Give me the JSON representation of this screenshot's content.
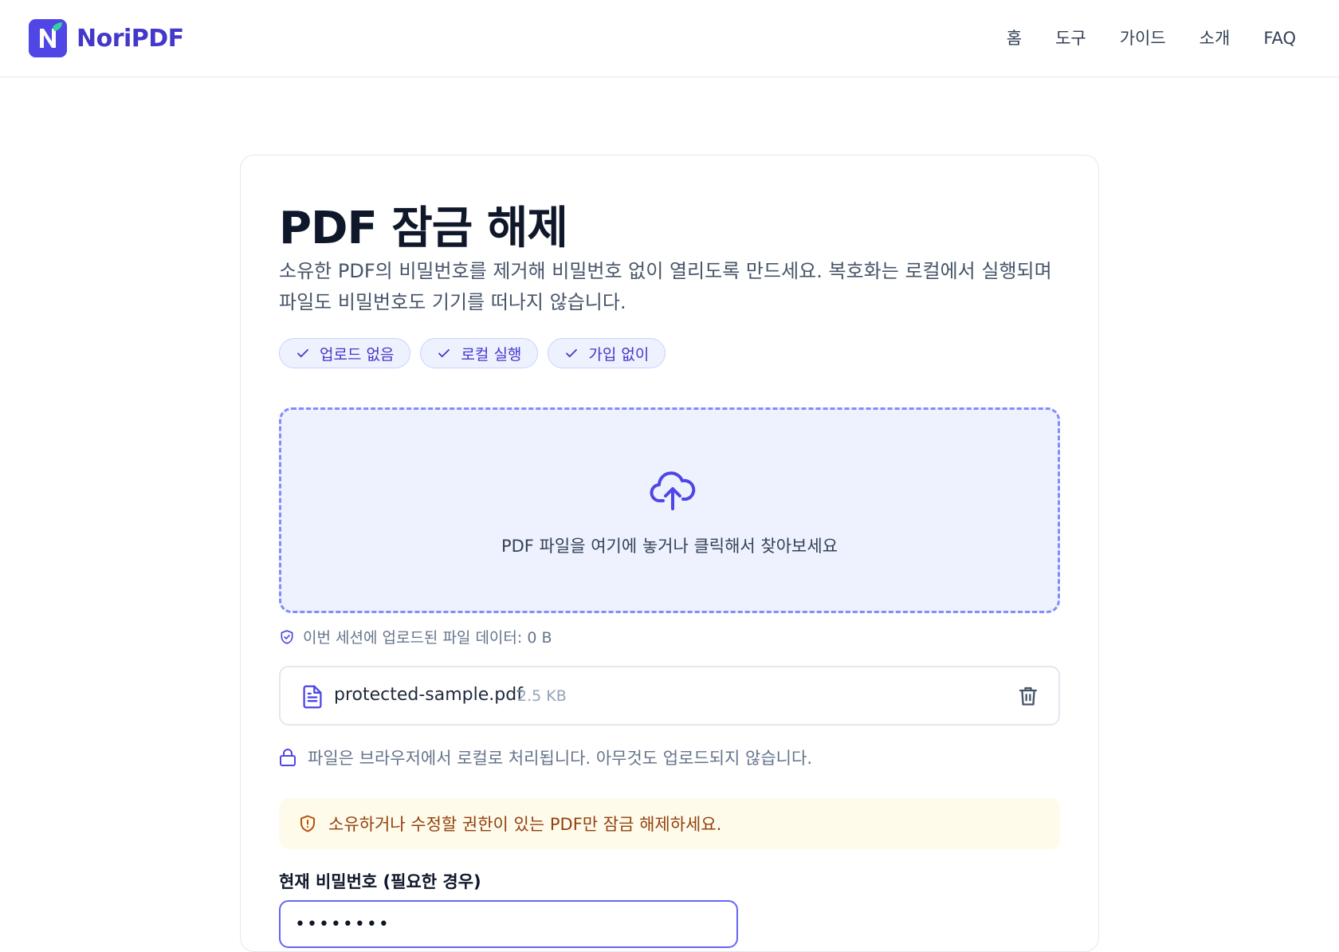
{
  "brand": {
    "name": "NoriPDF"
  },
  "nav": {
    "items": [
      "홈",
      "도구",
      "가이드",
      "소개",
      "FAQ"
    ]
  },
  "page": {
    "title": "PDF 잠금 해제",
    "description": "소유한 PDF의 비밀번호를 제거해 비밀번호 없이 열리도록 만드세요. 복호화는 로컬에서 실행되며 파일도 비밀번호도 기기를 떠나지 않습니다."
  },
  "badges": [
    "업로드 없음",
    "로컬 실행",
    "가입 없이"
  ],
  "dropzone": {
    "text": "PDF 파일을 여기에 놓거나 클릭해서 찾아보세요",
    "icon": "cloud-upload-icon"
  },
  "session": {
    "text": "이번 세션에 업로드된 파일 데이터: 0 B"
  },
  "file": {
    "name": "protected-sample.pdf",
    "size": "2.5 KB"
  },
  "local_note": "파일은 브라우저에서 로컬로 처리됩니다. 아무것도 업로드되지 않습니다.",
  "warning": "소유하거나 수정할 권한이 있는 PDF만 잠금 해제하세요.",
  "password": {
    "label": "현재 비밀번호 (필요한 경우)",
    "value": "••••••••"
  },
  "colors": {
    "accent": "#4f46e5",
    "dropzone_bg": "#eef2ff",
    "warning_bg": "#fffbeb",
    "warning_text": "#92400e"
  }
}
